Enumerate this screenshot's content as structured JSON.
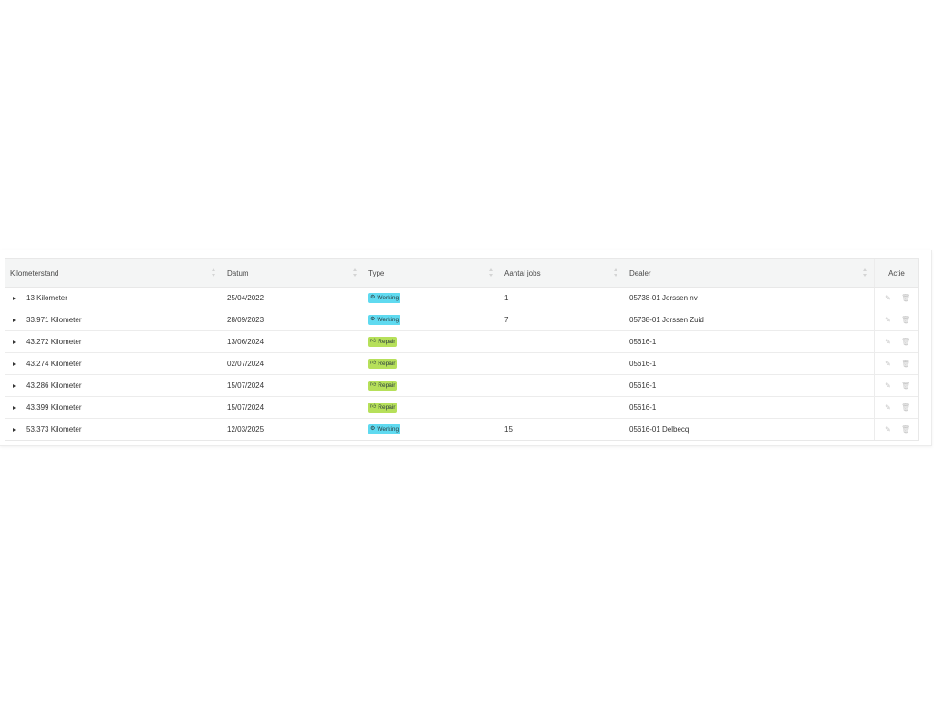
{
  "table": {
    "headers": {
      "kilometerstand": "Kilometerstand",
      "datum": "Datum",
      "type": "Type",
      "aantal_jobs": "Aantal jobs",
      "dealer": "Dealer",
      "actie": "Actie"
    },
    "rows": [
      {
        "kilometerstand": "13 Kilometer",
        "datum": "25/04/2022",
        "type": "Werking",
        "type_icon": "gear-icon",
        "aantal_jobs": "1",
        "dealer": "05738-01 Jorssen nv"
      },
      {
        "kilometerstand": "33.971 Kilometer",
        "datum": "28/09/2023",
        "type": "Werking",
        "type_icon": "gear-icon",
        "aantal_jobs": "7",
        "dealer": "05738-01 Jorssen Zuid"
      },
      {
        "kilometerstand": "43.272 Kilometer",
        "datum": "13/06/2024",
        "type": "Repair",
        "type_icon": "thumbs-up-icon",
        "aantal_jobs": "",
        "dealer": "05616-1"
      },
      {
        "kilometerstand": "43.274 Kilometer",
        "datum": "02/07/2024",
        "type": "Repair",
        "type_icon": "thumbs-up-icon",
        "aantal_jobs": "",
        "dealer": "05616-1"
      },
      {
        "kilometerstand": "43.286 Kilometer",
        "datum": "15/07/2024",
        "type": "Repair",
        "type_icon": "thumbs-up-icon",
        "aantal_jobs": "",
        "dealer": "05616-1"
      },
      {
        "kilometerstand": "43.399 Kilometer",
        "datum": "15/07/2024",
        "type": "Repair",
        "type_icon": "thumbs-up-icon",
        "aantal_jobs": "",
        "dealer": "05616-1"
      },
      {
        "kilometerstand": "53.373 Kilometer",
        "datum": "12/03/2025",
        "type": "Werking",
        "type_icon": "gear-icon",
        "aantal_jobs": "15",
        "dealer": "05616-01 Delbecq"
      }
    ]
  },
  "colors": {
    "werking_tag": "#5fdaf0",
    "repair_tag": "#b6e05a",
    "header_bg": "#f4f5f5",
    "action_icon": "#c4c4c4"
  }
}
